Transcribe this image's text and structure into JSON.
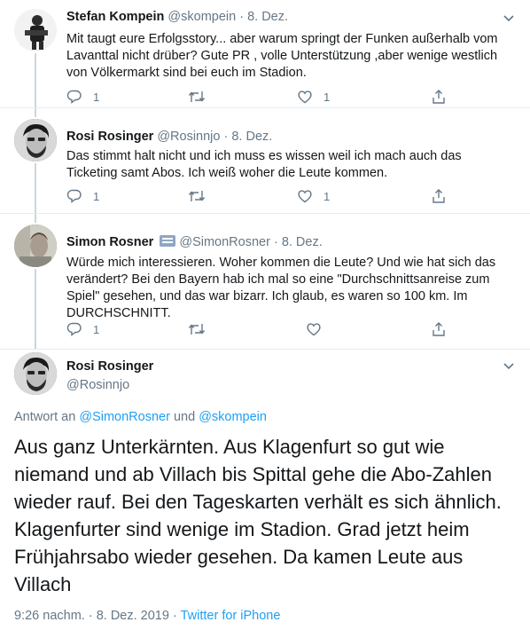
{
  "tweets": [
    {
      "name": "Stefan Kompein",
      "handle": "@skompein",
      "date": "8. Dez.",
      "text": "Mit taugt eure Erfolgsstory... aber warum springt der Funken außerhalb vom Lavanttal nicht drüber? Gute PR , volle Unterstützung ,aber wenige westlich von Völkermarkt sind bei euch im Stadion.",
      "reply_count": "1",
      "retweet_count": "",
      "like_count": "1"
    },
    {
      "name": "Rosi Rosinger",
      "handle": "@Rosinnjo",
      "date": "8. Dez.",
      "text": "Das stimmt halt nicht und ich muss es wissen weil ich mach auch das Ticketing samt Abos. Ich weiß woher die Leute kommen.",
      "reply_count": "1",
      "retweet_count": "",
      "like_count": "1"
    },
    {
      "name": "Simon Rosner",
      "handle": "@SimonRosner",
      "date": "8. Dez.",
      "text": "Würde mich interessieren. Woher kommen die Leute? Und wie hat sich das verändert? Bei den Bayern hab ich mal so eine \"Durchschnittsanreise zum Spiel\" gesehen, und das war bizarr. Ich glaub, es waren so 100 km. Im DURCHSCHNITT.",
      "reply_count": "1",
      "retweet_count": "",
      "like_count": ""
    }
  ],
  "main_tweet": {
    "name": "Rosi Rosinger",
    "handle": "@Rosinnjo",
    "reply_prefix": "Antwort an",
    "reply_user1": "@SimonRosner",
    "reply_and": "und",
    "reply_user2": "@skompein",
    "text": "Aus ganz Unterkärnten. Aus Klagenfurt so gut wie niemand und ab Villach bis Spittal gehe die Abo-Zahlen wieder rauf. Bei den Tageskarten verhält es sich ähnlich. Klagenfurter sind wenige im Stadion. Grad jetzt heim Frühjahrsabo wieder gesehen. Da kamen Leute aus Villach",
    "time": "9:26 nachm.",
    "date": "8. Dez. 2019",
    "source": "Twitter for iPhone",
    "separator": "·"
  },
  "colors": {
    "text": "#14171a",
    "secondary": "#657786",
    "link": "#1da1f2",
    "border": "#e6ecf0"
  }
}
